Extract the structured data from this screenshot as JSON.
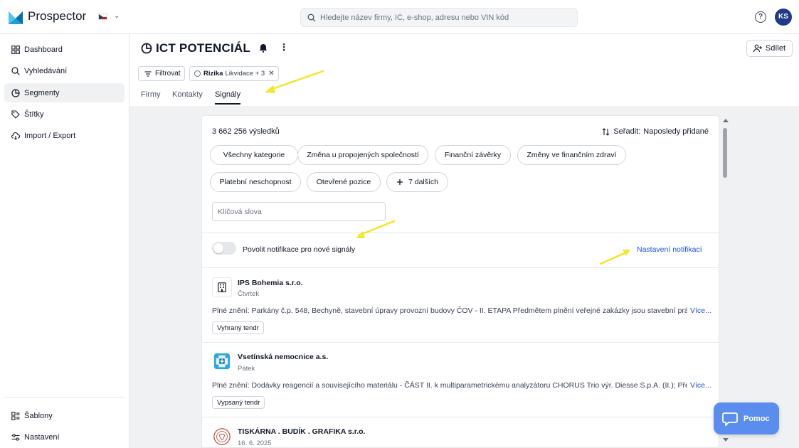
{
  "app": {
    "name": "Prospector"
  },
  "colors": {
    "accent": "#1d4ed8",
    "avatar": "#1e3a8a",
    "fab": "#5b8def",
    "annotation": "#f5e629"
  },
  "search": {
    "placeholder": "Hledejte název firmy, IČ, e-shop, adresu nebo VIN kód"
  },
  "user": {
    "initials": "KS"
  },
  "sidebar": {
    "items": [
      {
        "label": "Dashboard",
        "icon": "dashboard-icon"
      },
      {
        "label": "Vyhledávání",
        "icon": "search-icon"
      },
      {
        "label": "Segmenty",
        "icon": "pie-chart-icon",
        "active": true
      },
      {
        "label": "Štítky",
        "icon": "tag-icon"
      },
      {
        "label": "Import / Export",
        "icon": "cloud-sync-icon"
      }
    ],
    "bottom": [
      {
        "label": "Šablony",
        "icon": "templates-icon"
      },
      {
        "label": "Nastavení",
        "icon": "sliders-icon"
      }
    ]
  },
  "header": {
    "title": "ICT POTENCIÁL",
    "share_label": "Sdílet",
    "filter_label": "Filtrovat",
    "chip": {
      "key": "Rizika",
      "value": "Likvidace + 3"
    },
    "tabs": [
      "Firmy",
      "Kontakty",
      "Signály"
    ],
    "active_tab": "Signály"
  },
  "signals": {
    "results": "3 662 256 výsledků",
    "sort_label": "Seřadit:",
    "sort_value": "Naposledy přidané",
    "categories": [
      "Všechny kategorie",
      "Změna u propojených společností",
      "Finanční závěrky",
      "Změny ve finančním zdraví",
      "Platební neschopnost",
      "Otevřené pozice",
      "7 dalších"
    ],
    "keyword_placeholder": "Klíčová slova",
    "toggle_label": "Povolit notifikace pro nové signály",
    "toggle_on": false,
    "notif_link": "Nastavení notifikací",
    "items": [
      {
        "name": "IPS Bohemia s.r.o.",
        "date": "Čtvrtek",
        "text": "Plné znění: Parkány č.p. 548, Bechyně, stavební úpravy provozní budovy ČOV - II. ETAPA Předmětem plnění veřejné zakázky jsou stavební práce",
        "more": "Více...",
        "tag": "Vyhraný tendr",
        "logo": "building-icon"
      },
      {
        "name": "Vsetínská nemocnice a.s.",
        "date": "Pátek",
        "text": "Plné znění: Dodávky reagencií a souvisejícího materiálu - ČÁST II. k multiparametrickému analyzátoru CHORUS Trio výr. Diesse S.p.A. (II.); Předmět",
        "more": "Více...",
        "tag": "Vypsaný tendr",
        "logo": "hospital-logo"
      },
      {
        "name": "TISKÁRNA . BUDÍK . GRAFIKA s.r.o.",
        "date": "16. 6. 2025",
        "logo": "seal-logo"
      }
    ]
  },
  "help_fab": {
    "label": "Pomoc"
  }
}
